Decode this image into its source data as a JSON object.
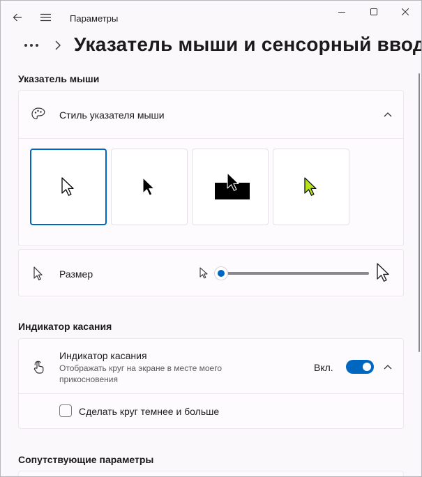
{
  "window": {
    "app_title": "Параметры",
    "controls": [
      "minimize-icon",
      "maximize-icon",
      "close-icon"
    ]
  },
  "breadcrumb": {
    "more": "•••",
    "page_title": "Указатель мыши и сенсорный ввод"
  },
  "sections": {
    "mouse_pointer": {
      "title": "Указатель мыши",
      "style_row": {
        "icon": "palette-icon",
        "label": "Стиль указателя мыши",
        "expanded": true,
        "options": [
          {
            "name": "white",
            "selected": true
          },
          {
            "name": "black",
            "selected": false
          },
          {
            "name": "inverted",
            "selected": false
          },
          {
            "name": "custom",
            "selected": false,
            "color": "#b7e219"
          }
        ]
      },
      "size_row": {
        "icon": "cursor-icon",
        "label": "Размер",
        "slider_value": 0
      }
    },
    "touch_indicator": {
      "title": "Индикатор касания",
      "row": {
        "icon": "touch-hand-icon",
        "label": "Индикатор касания",
        "description_line1": "Отображать круг на экране в месте моего",
        "description_line2": "прикосновения",
        "state_label": "Вкл.",
        "toggle_on": true
      },
      "checkbox": {
        "label": "Сделать круг темнее и больше",
        "checked": false
      }
    },
    "related": {
      "title": "Сопутствующие параметры"
    }
  },
  "colors": {
    "accent": "#0067c0",
    "custom_cursor": "#b7e219",
    "background": "#fbf8fc"
  }
}
